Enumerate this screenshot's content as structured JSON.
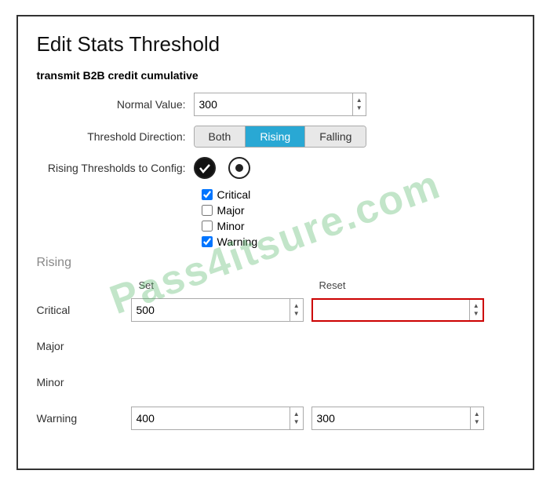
{
  "dialog": {
    "title": "Edit Stats Threshold",
    "section_label": "transmit B2B credit cumulative",
    "normal_value_label": "Normal Value:",
    "normal_value": "300",
    "threshold_direction_label": "Threshold Direction:",
    "threshold_buttons": [
      {
        "id": "both",
        "label": "Both",
        "active": false
      },
      {
        "id": "rising",
        "label": "Rising",
        "active": true
      },
      {
        "id": "falling",
        "label": "Falling",
        "active": false
      }
    ],
    "rising_config_label": "Rising Thresholds to Config:",
    "checkboxes": [
      {
        "label": "Critical",
        "checked": true
      },
      {
        "label": "Major",
        "checked": false
      },
      {
        "label": "Minor",
        "checked": false
      },
      {
        "label": "Warning",
        "checked": true
      }
    ],
    "rising_section": "Rising",
    "set_label": "Set",
    "reset_label": "Reset",
    "thresholds": [
      {
        "label": "Critical",
        "set_value": "500",
        "reset_value": "",
        "reset_error": true
      },
      {
        "label": "Major",
        "set_value": "",
        "reset_value": "",
        "reset_error": false
      },
      {
        "label": "Minor",
        "set_value": "",
        "reset_value": "",
        "reset_error": false
      },
      {
        "label": "Warning",
        "set_value": "400",
        "reset_value": "300",
        "reset_error": false
      }
    ],
    "watermark": "Pass4itsure.com"
  }
}
